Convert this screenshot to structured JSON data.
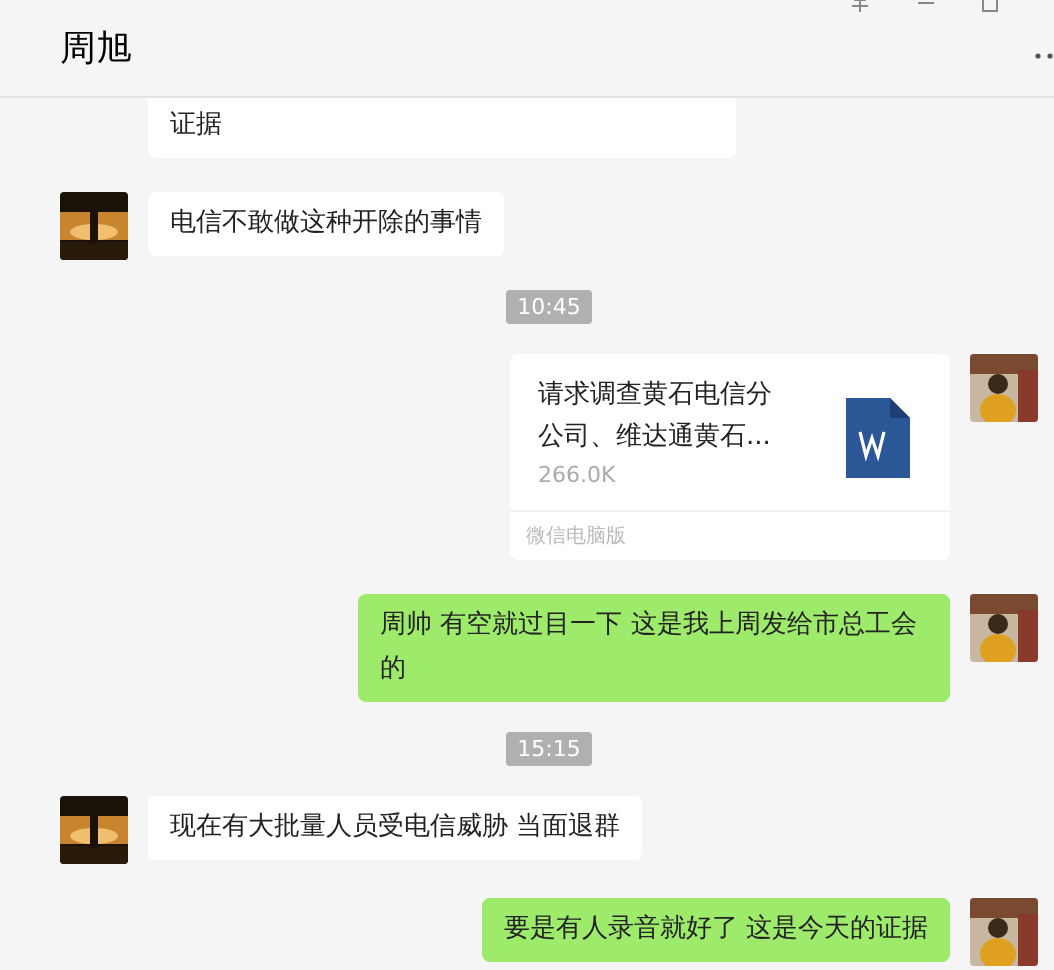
{
  "window": {
    "title": "周旭"
  },
  "messages": [
    {
      "kind": "incoming",
      "text": "证据"
    },
    {
      "kind": "incoming",
      "text": "电信不敢做这种开除的事情"
    },
    {
      "kind": "time",
      "text": "10:45"
    },
    {
      "kind": "outgoing_file",
      "name": "请求调查黄石电信分公司、维达通黄石...",
      "size": "266.0K",
      "source": "微信电脑版"
    },
    {
      "kind": "outgoing",
      "text": "周帅 有空就过目一下 这是我上周发给市总工会的"
    },
    {
      "kind": "time",
      "text": "15:15"
    },
    {
      "kind": "incoming",
      "text": "现在有大批量人员受电信威胁 当面退群"
    },
    {
      "kind": "outgoing",
      "text": "要是有人录音就好了 这是今天的证据"
    }
  ]
}
